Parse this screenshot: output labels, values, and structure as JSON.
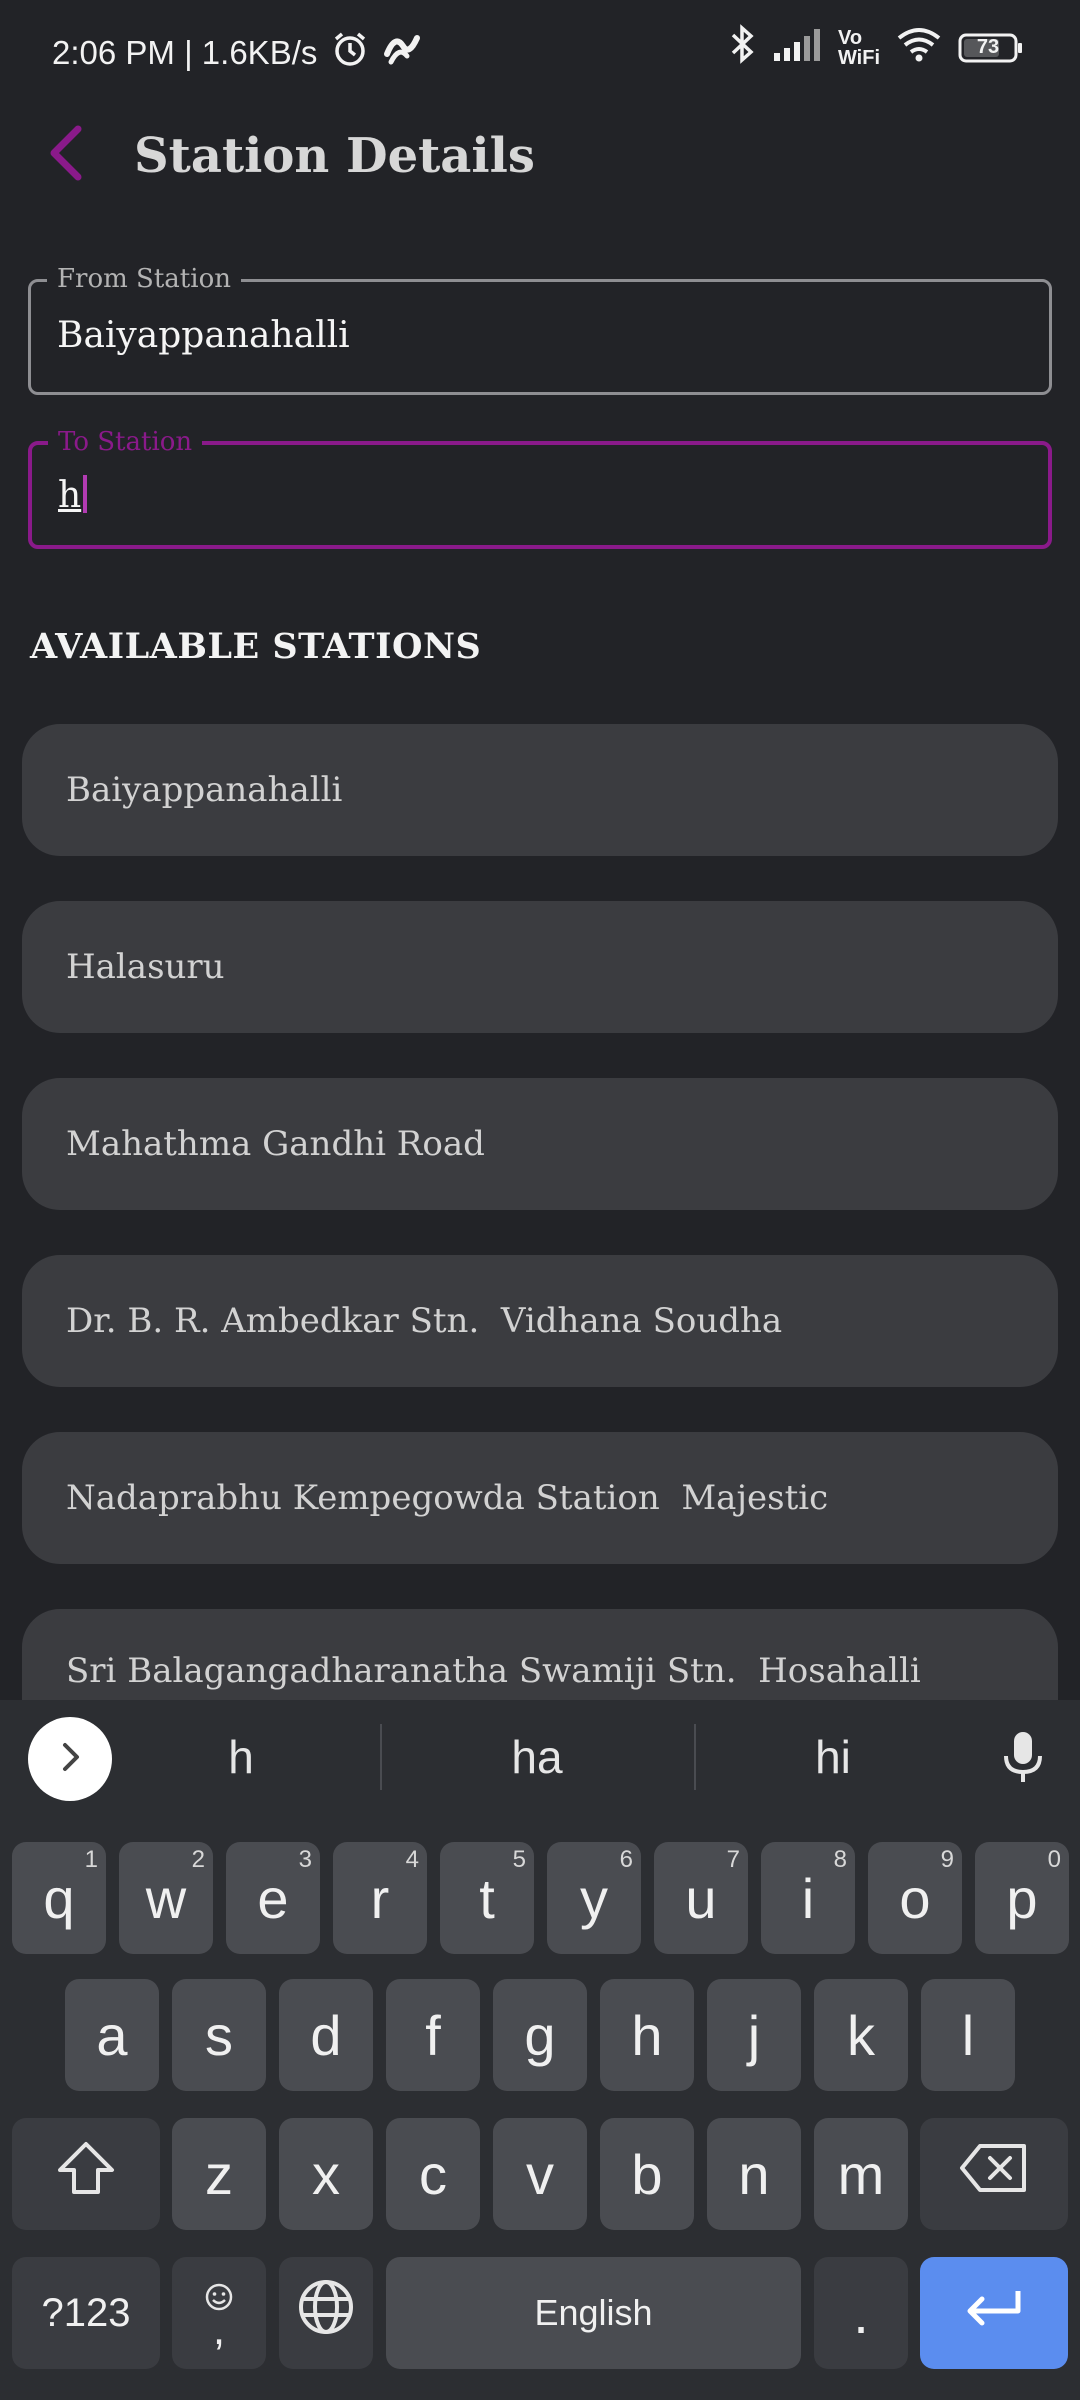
{
  "status_bar": {
    "time": "2:06 PM | 1.6KB/s",
    "vo_wifi_top": "Vo",
    "vo_wifi_bottom": "WiFi",
    "battery": "73"
  },
  "header": {
    "title": "Station Details"
  },
  "form": {
    "from": {
      "label": "From Station",
      "value": "Baiyappanahalli"
    },
    "to": {
      "label": "To Station",
      "value": "h"
    }
  },
  "available": {
    "title": "AVAILABLE STATIONS",
    "stations": [
      "Baiyappanahalli",
      "Halasuru",
      "Mahathma Gandhi Road",
      "Dr. B. R. Ambedkar Stn.  Vidhana Soudha",
      "Nadaprabhu Kempegowda Station  Majestic",
      "Sri Balagangadharanatha Swamiji Stn.  Hosahalli"
    ]
  },
  "keyboard": {
    "suggestions": [
      "h",
      "ha",
      "hi"
    ],
    "row1": [
      {
        "k": "q",
        "h": "1"
      },
      {
        "k": "w",
        "h": "2"
      },
      {
        "k": "e",
        "h": "3"
      },
      {
        "k": "r",
        "h": "4"
      },
      {
        "k": "t",
        "h": "5"
      },
      {
        "k": "y",
        "h": "6"
      },
      {
        "k": "u",
        "h": "7"
      },
      {
        "k": "i",
        "h": "8"
      },
      {
        "k": "o",
        "h": "9"
      },
      {
        "k": "p",
        "h": "0"
      }
    ],
    "row2": [
      "a",
      "s",
      "d",
      "f",
      "g",
      "h",
      "j",
      "k",
      "l"
    ],
    "row3": [
      "z",
      "x",
      "c",
      "v",
      "b",
      "n",
      "m"
    ],
    "symbols_key": "?123",
    "comma_key": ",",
    "space_label": "English",
    "period_key": "."
  },
  "colors": {
    "accent": "#8a1a8a",
    "background": "#222327",
    "list_item": "#3b3c40",
    "enter_key": "#5b8def"
  }
}
